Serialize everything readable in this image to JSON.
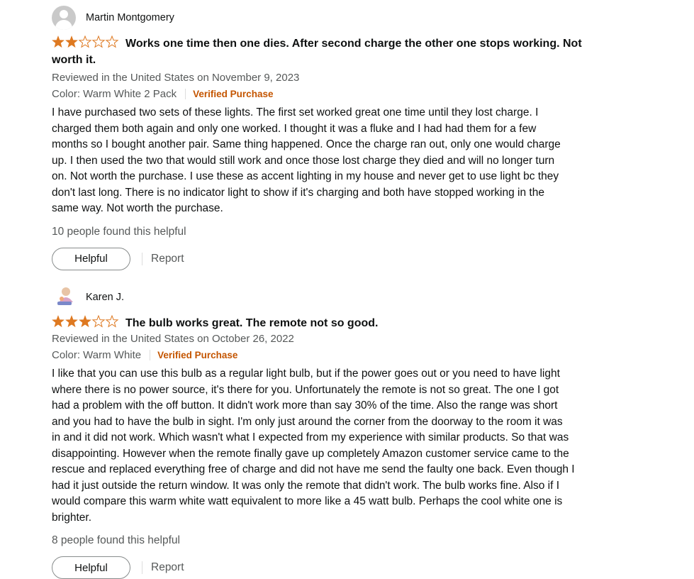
{
  "reviews": [
    {
      "author": "Martin Montgomery",
      "rating": 2,
      "title_line1": "Works one time then one dies. After second charge the other one stops working. Not",
      "title_line2": "worth it.",
      "reviewed_in": "Reviewed in the United States on November 9, 2023",
      "variant": "Color: Warm White 2 Pack",
      "verified": "Verified Purchase",
      "body": [
        "I have purchased two sets of these lights. The first set worked great one time until they lost charge. I",
        "charged them both again and only one worked. I thought it was a fluke and I had had them for a few",
        "months so I bought another pair. Same thing happened. Once the charge ran out, only one would charge",
        "up. I then used the two that would still work and once those lost charge they died and will no longer turn",
        "on. Not worth the purchase. I use these as accent lighting in my house and never get to use light bc they",
        "don't last long. There is no indicator light to show if it's charging and both have stopped working in the",
        "same way. Not worth the purchase."
      ],
      "helpful_count": "10 people found this helpful",
      "helpful_label": "Helpful",
      "report_label": "Report"
    },
    {
      "author": "Karen J.",
      "rating": 3,
      "title_line1": "The bulb works great. The remote not so good.",
      "reviewed_in": "Reviewed in the United States on October 26, 2022",
      "variant": "Color: Warm White",
      "verified": "Verified Purchase",
      "body": [
        "I like that you can use this bulb as a regular light bulb, but if the power goes out or you need to have light",
        "where there is no power source, it's there for you. Unfortunately the remote is not so great. The one I got",
        "had a problem with the off button. It didn't work more than say 30% of the time. Also the range was short",
        "and you had to have the bulb in sight. I'm only just around the corner from the doorway to the room it was",
        "in and it did not work. Which wasn't what I expected from my experience with similar products. So that was",
        "disappointing. However when the remote finally gave up completely Amazon customer service came to the",
        "rescue and replaced everything free of charge and did not have me send the faulty one back. Even though I",
        "had it just outside the return window. It was only the remote that didn't work. The bulb works fine. Also if I",
        "would compare this warm white watt equivalent to more like a 45 watt bulb. Perhaps the cool white one is",
        "brighter."
      ],
      "helpful_count": "8 people found this helpful",
      "helpful_label": "Helpful",
      "report_label": "Report"
    }
  ],
  "colors": {
    "star": "#de7921",
    "verified": "#c45500",
    "meta": "#565959"
  },
  "icons": {
    "star_filled": "star-filled-icon",
    "star_empty": "star-empty-icon",
    "avatar": "user-avatar-icon"
  }
}
